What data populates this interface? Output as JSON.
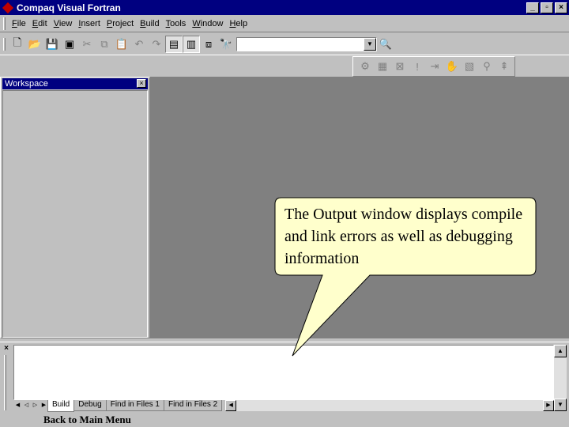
{
  "window": {
    "title": "Compaq Visual Fortran",
    "minimize": "_",
    "restore": "▫",
    "close": "×"
  },
  "menu": [
    "File",
    "Edit",
    "View",
    "Insert",
    "Project",
    "Build",
    "Tools",
    "Window",
    "Help"
  ],
  "toolbar": {
    "combo_value": "",
    "combo_arrow": "▼"
  },
  "workspace": {
    "title": "Workspace",
    "close": "×"
  },
  "output": {
    "close": "×",
    "tabs": [
      "Build",
      "Debug",
      "Find in Files 1",
      "Find in Files 2"
    ]
  },
  "callout": {
    "text": "The Output window displays compile and link errors as well as debugging information"
  },
  "footer": {
    "link": "Back to Main Menu"
  }
}
